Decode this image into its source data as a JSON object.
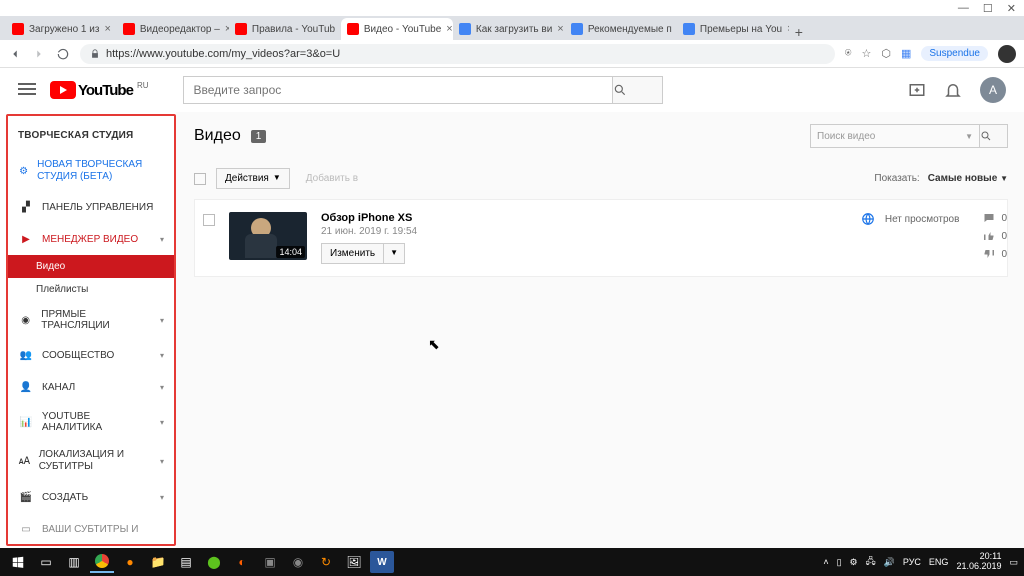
{
  "window": {
    "min": "—",
    "max": "☐",
    "close": "✕"
  },
  "tabs": [
    {
      "label": "Загружено 1 из",
      "fav": "#ff0000"
    },
    {
      "label": "Видеоредактор –",
      "fav": "#ff0000"
    },
    {
      "label": "Правила - YouTub",
      "fav": "#ff0000"
    },
    {
      "label": "Видео - YouTube",
      "fav": "#ff0000",
      "active": true
    },
    {
      "label": "Как загрузить ви",
      "fav": "#4285f4"
    },
    {
      "label": "Рекомендуемые п",
      "fav": "#4285f4"
    },
    {
      "label": "Премьеры на You",
      "fav": "#4285f4"
    }
  ],
  "url": "https://www.youtube.com/my_videos?ar=3&o=U",
  "suspend": "Suspendue",
  "logo_text": "YouTube",
  "logo_ru": "RU",
  "search_placeholder": "Введите запрос",
  "avatar": "A",
  "sidebar": {
    "title": "ТВОРЧЕСКАЯ СТУДИЯ",
    "new_studio": "НОВАЯ ТВОРЧЕСКАЯ СТУДИЯ (БЕТА)",
    "dashboard": "ПАНЕЛЬ УПРАВЛЕНИЯ",
    "video_mgr": "МЕНЕДЖЕР ВИДЕО",
    "videos": "Видео",
    "playlists": "Плейлисты",
    "live": "ПРЯМЫЕ ТРАНСЛЯЦИИ",
    "community": "СООБЩЕСТВО",
    "channel": "КАНАЛ",
    "analytics": "YOUTUBE АНАЛИТИКА",
    "loc": "ЛОКАЛИЗАЦИЯ И СУБТИТРЫ",
    "create": "СОЗДАТЬ",
    "subs": "ВАШИ СУБТИТРЫ И"
  },
  "page": {
    "title": "Видео",
    "count": "1",
    "video_search_ph": "Поиск видео",
    "actions": "Действия",
    "addto": "Добавить в",
    "show": "Показать:",
    "sort": "Самые новые"
  },
  "video": {
    "title": "Обзор iPhone XS",
    "date": "21 июн. 2019 г. 19:54",
    "duration": "14:04",
    "edit": "Изменить",
    "noviews": "Нет просмотров",
    "comments": "0",
    "likes": "0",
    "dislikes": "0"
  },
  "tray": {
    "lang": "РУС",
    "kbd": "ENG",
    "time": "20:11",
    "date": "21.06.2019"
  }
}
